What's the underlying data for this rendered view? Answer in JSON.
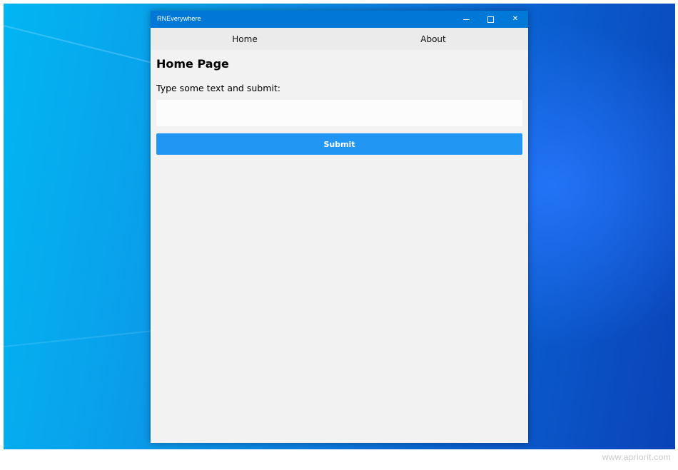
{
  "window": {
    "title": "RNEverywhere",
    "controls": {
      "minimize_icon": "minimize-icon",
      "maximize_icon": "maximize-icon",
      "close_glyph": "✕"
    }
  },
  "nav": {
    "items": [
      {
        "label": "Home"
      },
      {
        "label": "About"
      }
    ]
  },
  "page": {
    "title": "Home Page",
    "prompt": "Type some text and submit:",
    "input": {
      "value": "",
      "placeholder": ""
    },
    "submit_label": "Submit"
  },
  "watermark": "www.apriorit.com",
  "colors": {
    "titlebar": "#0078d7",
    "submit": "#2196f3",
    "window_bg": "#f2f2f2",
    "nav_bg": "#ebebeb"
  }
}
